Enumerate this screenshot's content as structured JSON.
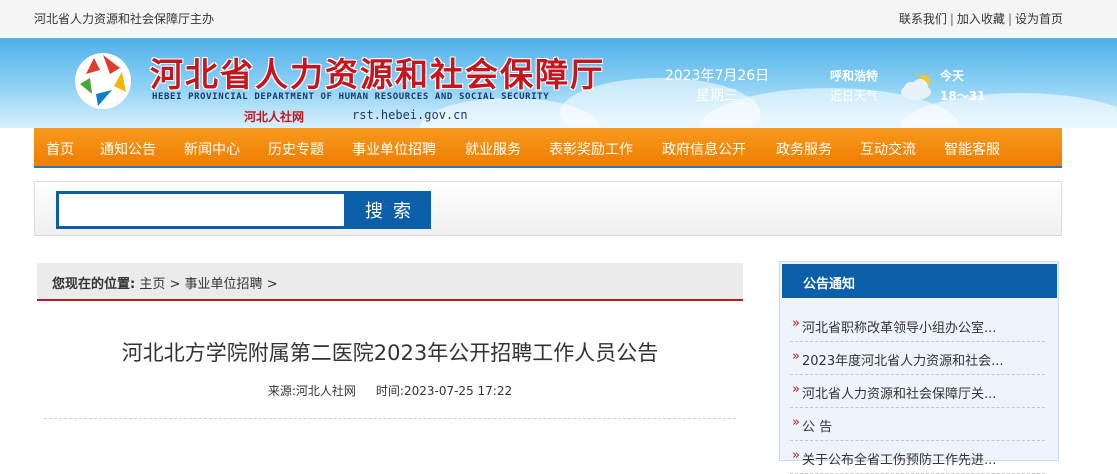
{
  "topbar": {
    "host_text": "河北省人力资源和社会保障厅主办",
    "links": [
      "联系我们",
      "加入收藏",
      "设为首页"
    ]
  },
  "header": {
    "title": "河北省人力资源和社会保障厅",
    "title_en": "HEBEI PROVINCIAL DEPARTMENT OF HUMAN RESOURCES AND SOCIAL SECURITY",
    "short_name": "河北人社网",
    "url": "rst.hebei.gov.cn",
    "date": "2023年7月26日",
    "weekday": "星期三",
    "city": "呼和浩特",
    "weather_label": "近日天气",
    "today_label": "今天",
    "temperature": "18～31",
    "weather_icon": "partly-cloudy-icon"
  },
  "nav": {
    "items": [
      "首页",
      "通知公告",
      "新闻中心",
      "历史专题",
      "事业单位招聘",
      "就业服务",
      "表彰奖励工作",
      "政府信息公开",
      "政务服务",
      "互动交流",
      "智能客服"
    ]
  },
  "search": {
    "placeholder": "",
    "button_label": "搜索"
  },
  "breadcrumb": {
    "label": "您现在的位置:",
    "home": "主页",
    "section": "事业单位招聘",
    "sep": ">"
  },
  "article": {
    "title": "河北北方学院附属第二医院2023年公开招聘工作人员公告",
    "source": "来源:河北人社网",
    "time": "时间:2023-07-25 17:22"
  },
  "notice": {
    "heading": "公告通知",
    "items": [
      "河北省职称改革领导小组办公室...",
      "2023年度河北省人力资源和社会...",
      "河北省人力资源和社会保障厅关...",
      "公 告",
      "关于公布全省工伤预防工作先进..."
    ]
  },
  "colors": {
    "nav_orange": "#ef7d00",
    "brand_blue": "#0b5ea8",
    "title_red": "#c4161c"
  }
}
